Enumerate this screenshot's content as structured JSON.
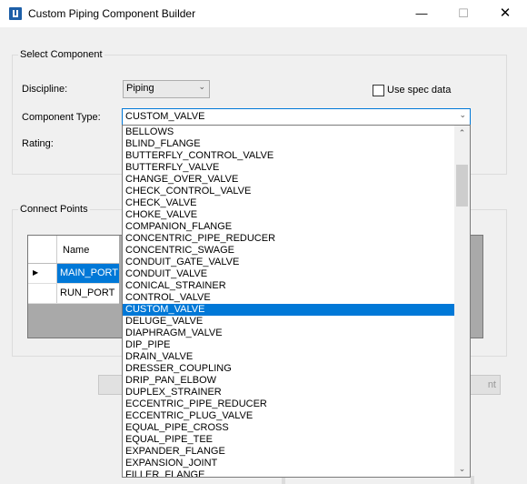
{
  "window": {
    "title": "Custom Piping Component Builder"
  },
  "select_component": {
    "legend": "Select Component",
    "discipline_label": "Discipline:",
    "discipline_value": "Piping",
    "use_spec_label": "Use spec data",
    "component_type_label": "Component Type:",
    "component_type_value": "CUSTOM_VALVE",
    "rating_label": "Rating:"
  },
  "connect_points": {
    "legend": "Connect Points",
    "column_name": "Name",
    "rows": [
      "MAIN_PORT",
      "RUN_PORT"
    ]
  },
  "buttons": {
    "right_partial": "nt"
  },
  "dropdown": {
    "items": [
      "BELLOWS",
      "BLIND_FLANGE",
      "BUTTERFLY_CONTROL_VALVE",
      "BUTTERFLY_VALVE",
      "CHANGE_OVER_VALVE",
      "CHECK_CONTROL_VALVE",
      "CHECK_VALVE",
      "CHOKE_VALVE",
      "COMPANION_FLANGE",
      "CONCENTRIC_PIPE_REDUCER",
      "CONCENTRIC_SWAGE",
      "CONDUIT_GATE_VALVE",
      "CONDUIT_VALVE",
      "CONICAL_STRAINER",
      "CONTROL_VALVE",
      "CUSTOM_VALVE",
      "DELUGE_VALVE",
      "DIAPHRAGM_VALVE",
      "DIP_PIPE",
      "DRAIN_VALVE",
      "DRESSER_COUPLING",
      "DRIP_PAN_ELBOW",
      "DUPLEX_STRAINER",
      "ECCENTRIC_PIPE_REDUCER",
      "ECCENTRIC_PLUG_VALVE",
      "EQUAL_PIPE_CROSS",
      "EQUAL_PIPE_TEE",
      "EXPANDER_FLANGE",
      "EXPANSION_JOINT",
      "FILLER_FLANGE"
    ],
    "selected": "CUSTOM_VALVE"
  },
  "colors": {
    "accent": "#0078d7"
  }
}
